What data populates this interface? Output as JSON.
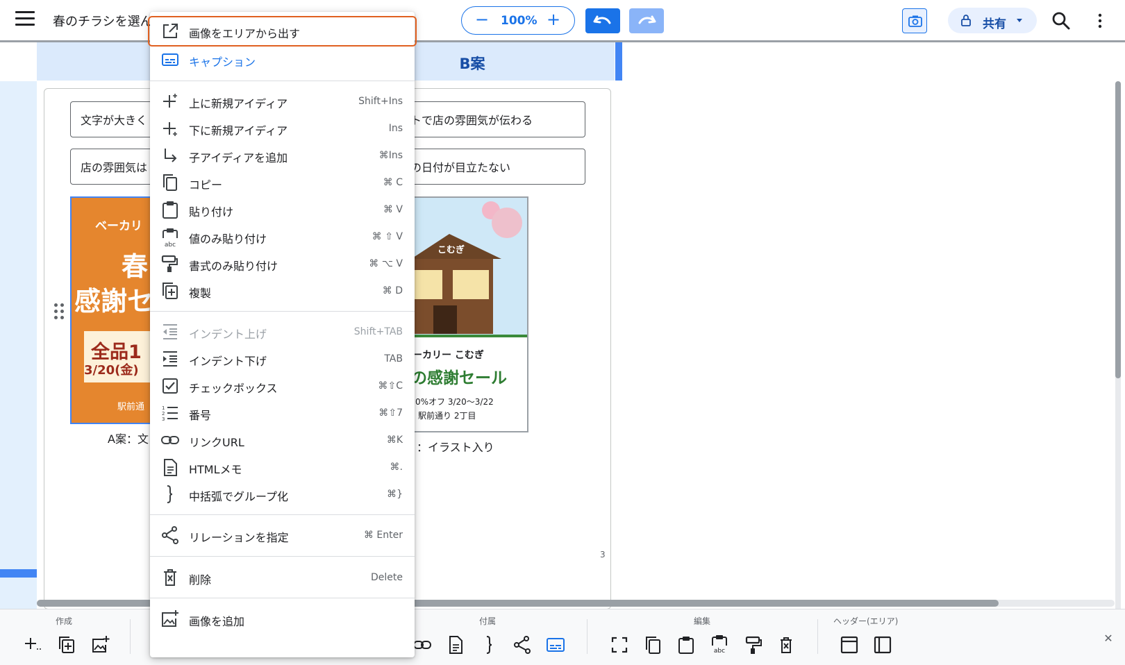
{
  "topbar": {
    "doc_title": "春のチラシを選ん",
    "zoom_minus": "−",
    "zoom_value": "100%",
    "zoom_plus": "+",
    "share_label": "共有"
  },
  "column": {
    "title": "B案"
  },
  "notes": {
    "n1": "文字が大きく",
    "n2": "トで店の雰囲気が伝わる",
    "n3": "店の雰囲気は",
    "n4": "の日付が目立たない"
  },
  "imageA": {
    "line1": "ベーカリ",
    "line2": "春",
    "line3": "感謝セ",
    "line4": "全品1",
    "line5": "3/20(金)",
    "line6": "駅前通",
    "caption": "A案：文"
  },
  "imageB": {
    "sign": "こむぎ",
    "line1": "ーカリー こむぎ",
    "line2": "の感謝セール",
    "line3": "0%オフ 3/20〜3/22",
    "line4": "駅前通り 2丁目",
    "caption": "：イラスト入り"
  },
  "page_number": "3",
  "toolbar": {
    "groups": [
      "作成",
      "付属",
      "編集",
      "ヘッダー(エリア)"
    ],
    "close": "✕",
    "icons": [
      "add-idea-icon",
      "duplicate-icon",
      "add-image-icon",
      "link-icon",
      "html-memo-icon",
      "brace-group-icon",
      "relation-icon",
      "caption-icon",
      "fullscreen-icon",
      "copy-icon",
      "paste-icon",
      "paste-value-icon",
      "paste-format-icon",
      "delete-icon",
      "header-top-icon",
      "header-side-icon"
    ]
  },
  "menu": {
    "items": [
      {
        "label": "画像をエリアから出す",
        "shortcut": "",
        "icon": "open-external-icon"
      },
      {
        "label": "キャプション",
        "shortcut": "",
        "icon": "caption-icon"
      },
      {
        "label": "上に新規アイディア",
        "shortcut": "Shift+Ins",
        "icon": "add-above-icon"
      },
      {
        "label": "下に新規アイディア",
        "shortcut": "Ins",
        "icon": "add-below-icon"
      },
      {
        "label": "子アイディアを追加",
        "shortcut": "⌘Ins",
        "icon": "child-arrow-icon"
      },
      {
        "label": "コピー",
        "shortcut": "⌘ C",
        "icon": "copy-icon"
      },
      {
        "label": "貼り付け",
        "shortcut": "⌘ V",
        "icon": "paste-icon"
      },
      {
        "label": "値のみ貼り付け",
        "shortcut": "⌘ ⇧ V",
        "icon": "paste-value-icon"
      },
      {
        "label": "書式のみ貼り付け",
        "shortcut": "⌘ ⌥ V",
        "icon": "paste-format-icon"
      },
      {
        "label": "複製",
        "shortcut": "⌘ D",
        "icon": "duplicate-icon"
      },
      {
        "label": "インデント上げ",
        "shortcut": "Shift+TAB",
        "icon": "outdent-icon"
      },
      {
        "label": "インデント下げ",
        "shortcut": "TAB",
        "icon": "indent-icon"
      },
      {
        "label": "チェックボックス",
        "shortcut": "⌘⇧C",
        "icon": "checkbox-icon"
      },
      {
        "label": "番号",
        "shortcut": "⌘⇧7",
        "icon": "numbered-list-icon"
      },
      {
        "label": "リンクURL",
        "shortcut": "⌘K",
        "icon": "link-icon"
      },
      {
        "label": "HTMLメモ",
        "shortcut": "⌘.",
        "icon": "html-memo-icon"
      },
      {
        "label": "中括弧でグループ化",
        "shortcut": "⌘}",
        "icon": "brace-group-icon"
      },
      {
        "label": "リレーションを指定",
        "shortcut": "⌘ Enter",
        "icon": "relation-icon"
      },
      {
        "label": "削除",
        "shortcut": "Delete",
        "icon": "delete-icon"
      },
      {
        "label": "画像を追加",
        "shortcut": "",
        "icon": "add-image-icon"
      }
    ]
  },
  "colors": {
    "accent": "#1a73e8",
    "highlight_outline": "#e06020",
    "column_header": "#dbeafc",
    "flyer_orange": "#e5862e"
  }
}
